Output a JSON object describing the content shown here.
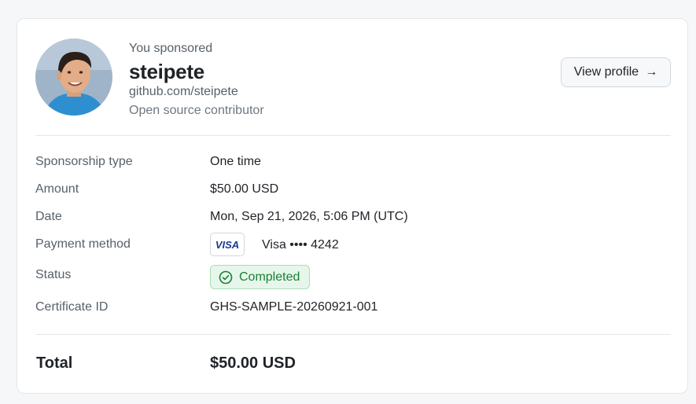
{
  "sponsor": {
    "you_sponsored": "You sponsored",
    "username": "steipete",
    "github_url": "github.com/steipete",
    "role": "Open source contributor",
    "view_profile_label": "View profile",
    "view_profile_arrow": "→"
  },
  "details": {
    "sponsorship_type_label": "Sponsorship type",
    "sponsorship_type_value": "One time",
    "amount_label": "Amount",
    "amount_value": "$50.00 USD",
    "date_label": "Date",
    "date_value": "Mon, Sep 21, 2026, 5:06 PM (UTC)",
    "payment_method_label": "Payment method",
    "card_brand_badge": "VISA",
    "payment_method_value": "Visa •••• 4242",
    "status_label": "Status",
    "status_value": "Completed",
    "certificate_label": "Certificate ID",
    "certificate_value": "GHS-SAMPLE-20260921-001"
  },
  "total": {
    "label": "Total",
    "value": "$50.00 USD"
  },
  "colors": {
    "status_green": "#1a7f37",
    "status_bg": "#e6f6ea",
    "visa_blue": "#1a3a8f"
  }
}
